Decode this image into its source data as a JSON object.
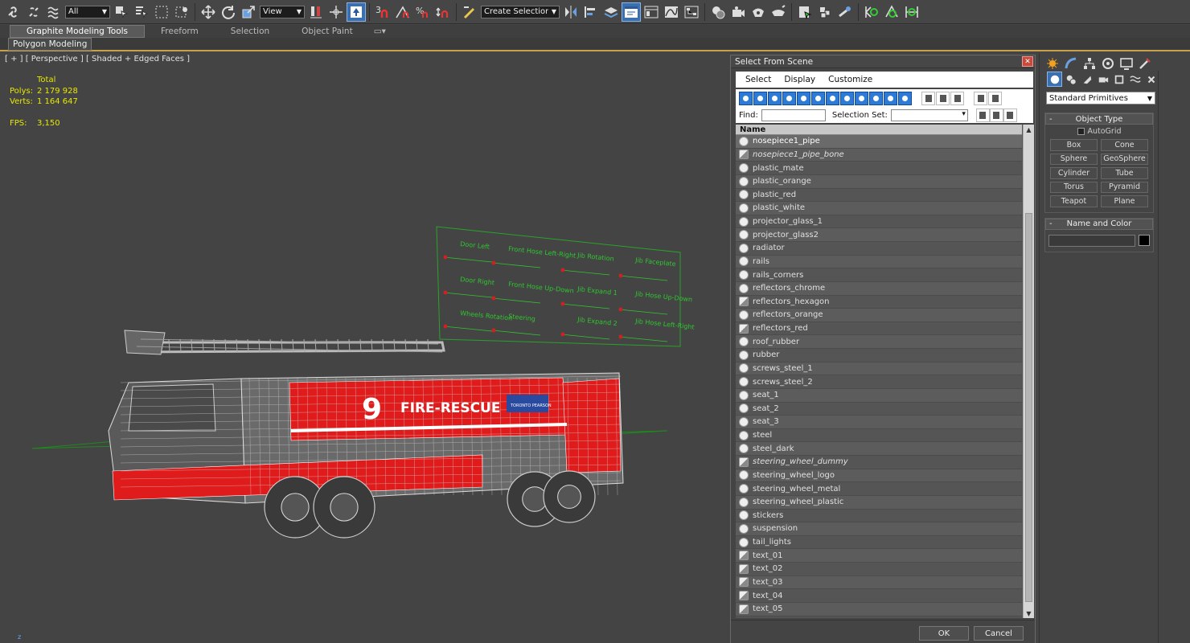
{
  "toolbar": {
    "filter_value": "All",
    "refcoord_value": "View",
    "snap_label": "3",
    "selection_set_value": "Create Selection Se"
  },
  "ribbon": {
    "tabs": [
      "Graphite Modeling Tools",
      "Freeform",
      "Selection",
      "Object Paint"
    ],
    "active_panel": "Polygon Modeling"
  },
  "viewport": {
    "label": "[ + ] [ Perspective ] [ Shaded + Edged Faces ]",
    "stats": {
      "total_label": "Total",
      "polys_label": "Polys:",
      "polys_value": "2 179 928",
      "verts_label": "Verts:",
      "verts_value": "1 164 647",
      "fps_label": "FPS:",
      "fps_value": "3,150"
    },
    "truck": {
      "number": "9",
      "text": "FIRE-RESCUE",
      "logo": "TORONTO PEARSON"
    },
    "panel_labels": [
      "Door Left",
      "Front Hose Left-Right",
      "Jib Rotation",
      "Jib Faceplate",
      "Door Right",
      "Front Hose Up-Down",
      "Jib Expand 1",
      "Jib Hose Up-Down",
      "Wheels Rotation",
      "Steering",
      "Jib Expand 2",
      "Jib Hose Left-Right"
    ],
    "axis_label": "z"
  },
  "dialog": {
    "title": "Select From Scene",
    "menu": [
      "Select",
      "Display",
      "Customize"
    ],
    "find_label": "Find:",
    "selection_set_label": "Selection Set:",
    "column_name": "Name",
    "items": [
      {
        "name": "nosepiece1_pipe",
        "type": "object",
        "selected": true,
        "italic": false
      },
      {
        "name": "nosepiece1_pipe_bone",
        "type": "group",
        "selected": false,
        "italic": true
      },
      {
        "name": "plastic_mate",
        "type": "object",
        "selected": false,
        "italic": false
      },
      {
        "name": "plastic_orange",
        "type": "object",
        "selected": false,
        "italic": false
      },
      {
        "name": "plastic_red",
        "type": "object",
        "selected": false,
        "italic": false
      },
      {
        "name": "plastic_white",
        "type": "object",
        "selected": false,
        "italic": false
      },
      {
        "name": "projector_glass_1",
        "type": "object",
        "selected": false,
        "italic": false
      },
      {
        "name": "projector_glass2",
        "type": "object",
        "selected": false,
        "italic": false
      },
      {
        "name": "radiator",
        "type": "object",
        "selected": false,
        "italic": false
      },
      {
        "name": "rails",
        "type": "object",
        "selected": false,
        "italic": false
      },
      {
        "name": "rails_corners",
        "type": "object",
        "selected": false,
        "italic": false
      },
      {
        "name": "reflectors_chrome",
        "type": "object",
        "selected": false,
        "italic": false
      },
      {
        "name": "reflectors_hexagon",
        "type": "group",
        "selected": false,
        "italic": false
      },
      {
        "name": "reflectors_orange",
        "type": "object",
        "selected": false,
        "italic": false
      },
      {
        "name": "reflectors_red",
        "type": "group",
        "selected": false,
        "italic": false
      },
      {
        "name": "roof_rubber",
        "type": "object",
        "selected": false,
        "italic": false
      },
      {
        "name": "rubber",
        "type": "object",
        "selected": false,
        "italic": false
      },
      {
        "name": "screws_steel_1",
        "type": "object",
        "selected": false,
        "italic": false
      },
      {
        "name": "screws_steel_2",
        "type": "object",
        "selected": false,
        "italic": false
      },
      {
        "name": "seat_1",
        "type": "object",
        "selected": false,
        "italic": false
      },
      {
        "name": "seat_2",
        "type": "object",
        "selected": false,
        "italic": false
      },
      {
        "name": "seat_3",
        "type": "object",
        "selected": false,
        "italic": false
      },
      {
        "name": "steel",
        "type": "object",
        "selected": false,
        "italic": false
      },
      {
        "name": "steel_dark",
        "type": "object",
        "selected": false,
        "italic": false
      },
      {
        "name": "steering_wheel_dummy",
        "type": "group",
        "selected": false,
        "italic": true
      },
      {
        "name": "steering_wheel_logo",
        "type": "object",
        "selected": false,
        "italic": false
      },
      {
        "name": "steering_wheel_metal",
        "type": "object",
        "selected": false,
        "italic": false
      },
      {
        "name": "steering_wheel_plastic",
        "type": "object",
        "selected": false,
        "italic": false
      },
      {
        "name": "stickers",
        "type": "object",
        "selected": false,
        "italic": false
      },
      {
        "name": "suspension",
        "type": "object",
        "selected": false,
        "italic": false
      },
      {
        "name": "tail_lights",
        "type": "object",
        "selected": false,
        "italic": false
      },
      {
        "name": "text_01",
        "type": "group",
        "selected": false,
        "italic": false
      },
      {
        "name": "text_02",
        "type": "group",
        "selected": false,
        "italic": false
      },
      {
        "name": "text_03",
        "type": "group",
        "selected": false,
        "italic": false
      },
      {
        "name": "text_04",
        "type": "group",
        "selected": false,
        "italic": false
      },
      {
        "name": "text_05",
        "type": "group",
        "selected": false,
        "italic": false
      }
    ],
    "ok_label": "OK",
    "cancel_label": "Cancel"
  },
  "command_panel": {
    "category_value": "Standard Primitives",
    "object_type_title": "Object Type",
    "autogrid_label": "AutoGrid",
    "primitives": [
      "Box",
      "Cone",
      "Sphere",
      "GeoSphere",
      "Cylinder",
      "Tube",
      "Torus",
      "Pyramid",
      "Teapot",
      "Plane"
    ],
    "name_color_title": "Name and Color",
    "object_color": "#000000"
  },
  "colors": {
    "accent": "#3a6fb0",
    "wire_green": "#29a329",
    "truck_red": "#e01b1b",
    "stats_yellow": "#e8e800"
  }
}
